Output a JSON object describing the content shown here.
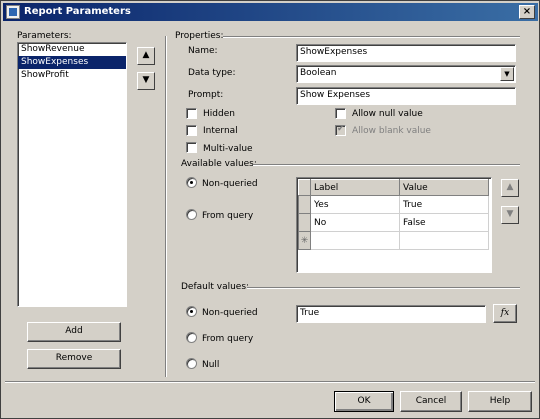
{
  "window": {
    "title": "Report Parameters",
    "close_glyph": "×"
  },
  "parameters": {
    "label": "Parameters:",
    "items": [
      "ShowRevenue",
      "ShowExpenses",
      "ShowProfit"
    ],
    "selected_index": 1,
    "add_label": "Add",
    "remove_label": "Remove",
    "up_glyph": "▲",
    "down_glyph": "▼"
  },
  "properties": {
    "label": "Properties:",
    "name_label": "Name:",
    "name_value": "ShowExpenses",
    "datatype_label": "Data type:",
    "datatype_value": "Boolean",
    "prompt_label": "Prompt:",
    "prompt_value": "Show Expenses",
    "hidden_label": "Hidden",
    "internal_label": "Internal",
    "multivalue_label": "Multi-value",
    "allow_null_label": "Allow null value",
    "allow_blank_label": "Allow blank value"
  },
  "available": {
    "label": "Available values:",
    "nonqueried_label": "Non-queried",
    "fromquery_label": "From query",
    "columns": [
      "Label",
      "Value"
    ],
    "rows": [
      [
        "Yes",
        "True"
      ],
      [
        "No",
        "False"
      ]
    ],
    "new_row_glyph": "✳"
  },
  "defaults": {
    "label": "Default values:",
    "nonqueried_label": "Non-queried",
    "fromquery_label": "From query",
    "null_label": "Null",
    "value": "True",
    "fx_label": "fx"
  },
  "footer": {
    "ok_label": "OK",
    "cancel_label": "Cancel",
    "help_label": "Help"
  }
}
